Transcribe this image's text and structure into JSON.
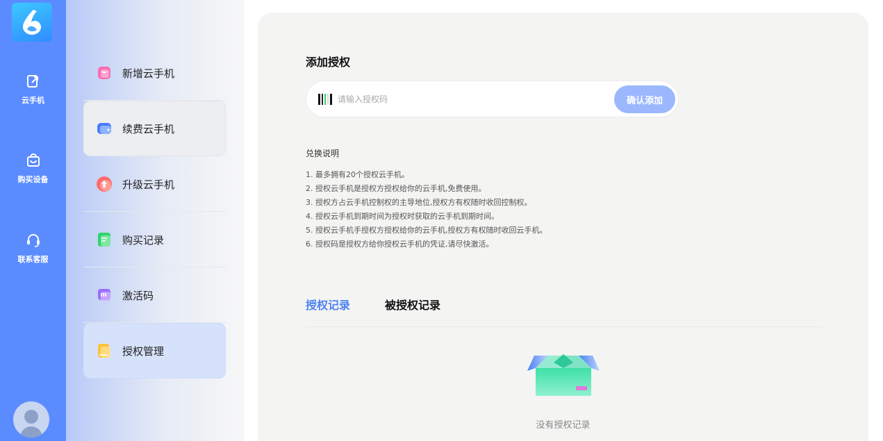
{
  "rail": {
    "items": [
      {
        "label": "云手机",
        "icon": "phone-share-icon"
      },
      {
        "label": "购买设备",
        "icon": "shopping-bag-icon"
      },
      {
        "label": "联系客服",
        "icon": "headset-icon"
      }
    ]
  },
  "submenu": {
    "items": [
      {
        "label": "新增云手机",
        "icon": "shopping-bag-icon",
        "color": "#ff5fa8"
      },
      {
        "label": "续费云手机",
        "icon": "wallet-icon",
        "color": "#4a7dff"
      },
      {
        "label": "升级云手机",
        "icon": "upgrade-icon",
        "color": "#ff6b6b"
      },
      {
        "label": "购买记录",
        "icon": "document-icon",
        "color": "#2fd46b"
      },
      {
        "label": "激活码",
        "icon": "code-icon",
        "color": "#9b6cff"
      },
      {
        "label": "授权管理",
        "icon": "folder-icon",
        "color": "#ffc23d"
      }
    ]
  },
  "main": {
    "title": "添加授权",
    "input_placeholder": "请输入授权码",
    "confirm_label": "确认添加",
    "instructions_title": "兑换说明",
    "instructions": [
      "1. 最多拥有20个授权云手机。",
      "2. 授权云手机是授权方授权给你的云手机,免费使用。",
      "3. 授权方占云手机控制权的主导地位,授权方有权随时收回控制权。",
      "4. 授权云手机到期时间为授权时获取的云手机到期时间。",
      "5. 授权云手机手授权方授权给你的云手机,授权方有权随时收回云手机。",
      "6. 授权码是授权方给你授权云手机的凭证,请尽快激活。"
    ],
    "tabs": [
      {
        "label": "授权记录",
        "active": true
      },
      {
        "label": "被授权记录",
        "active": false
      }
    ],
    "empty_text": "没有授权记录"
  },
  "colors": {
    "accent": "#4c82f3",
    "rail": "#5b8cff",
    "button": "#9bb8ff"
  }
}
